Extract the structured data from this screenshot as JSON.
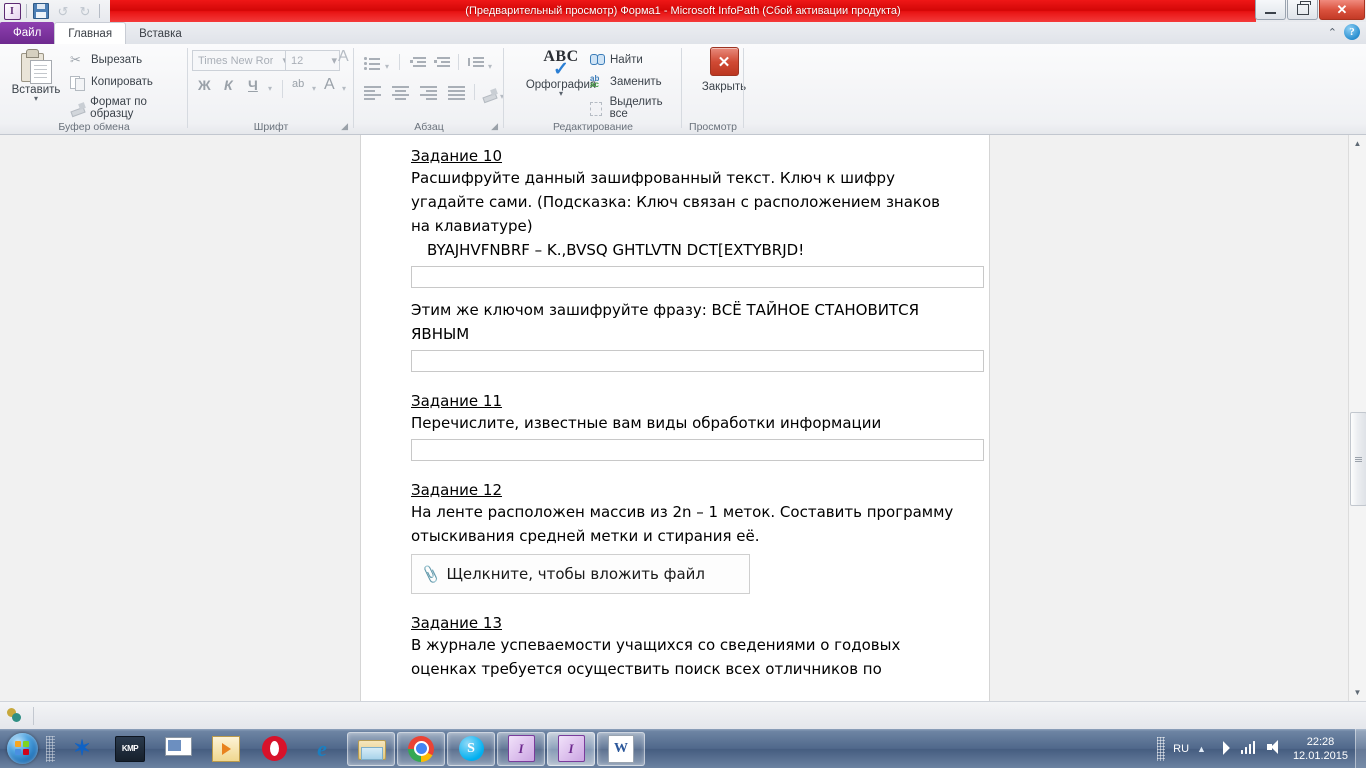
{
  "window": {
    "title": "(Предварительный просмотр) Форма1  -  Microsoft InfoPath (Сбой активации продукта)",
    "minimize_label": "",
    "restore_label": "",
    "close_label": "✕"
  },
  "quick_access": {
    "app_icon": "infopath-icon",
    "save_label": "save-icon",
    "undo_label": "↺",
    "redo_label": "↻",
    "customize_label": "▾"
  },
  "tabs": [
    {
      "label": "Файл",
      "id": "tab-file",
      "active": false
    },
    {
      "label": "Главная",
      "id": "tab-home",
      "active": true
    },
    {
      "label": "Вставка",
      "id": "tab-insert",
      "active": false
    }
  ],
  "ribbon_right": {
    "collapse_icon": "⌃",
    "help_icon": "?"
  },
  "ribbon": {
    "clipboard": {
      "group_label": "Буфер обмена",
      "paste_label": "Вставить",
      "paste_arrow": "▾",
      "cut_label": "Вырезать",
      "copy_label": "Копировать",
      "format_painter_label": "Формат по образцу"
    },
    "font": {
      "group_label": "Шрифт",
      "font_name": "Times New Ror",
      "font_size": "12",
      "bold_label": "Ж",
      "italic_label": "К",
      "underline_label": "Ч",
      "clear_format_label": "A",
      "highlight_label": "ab",
      "font_color_label": "A",
      "dropdown_arrow": "▾"
    },
    "paragraph": {
      "group_label": "Абзац",
      "bullets_label": "bullet-list-icon",
      "decrease_indent_label": "decrease-indent-icon",
      "increase_indent_label": "increase-indent-icon",
      "line_spacing_label": "line-spacing-icon",
      "align_left_label": "align-left-icon",
      "align_center_label": "align-center-icon",
      "align_right_label": "align-right-icon",
      "align_justify_label": "align-justify-icon",
      "shading_label": "shading-icon",
      "dialog_launcher": "◢"
    },
    "editing": {
      "group_label": "Редактирование",
      "spelling_label": "Орфография",
      "spelling_glyph": "ABC",
      "spelling_check": "✓",
      "spelling_arrow": "▾",
      "find_label": "Найти",
      "replace_label": "Заменить",
      "select_all_label": "Выделить все"
    },
    "preview": {
      "group_label": "Просмотр",
      "close_label": "Закрыть",
      "close_glyph": "✕"
    }
  },
  "document": {
    "blocks": [
      {
        "type": "task",
        "title": "Задание 10",
        "paragraphs": [
          "Расшифруйте данный зашифрованный текст. Ключ к шифру угадайте сами. (Подсказка: Ключ связан с расположением знаков на клавиатуре)"
        ],
        "cipher": "BYAJHVFNBRF – K.,BVSQ GHTLVTN DCT[EXTYBRJD!",
        "field_value": ""
      },
      {
        "type": "prompt",
        "paragraphs": [
          "Этим же ключом зашифруйте фразу: ВСЁ ТАЙНОЕ СТАНОВИТСЯ ЯВНЫМ"
        ],
        "field_value": ""
      },
      {
        "type": "task",
        "title": "Задание 11",
        "paragraphs": [
          "Перечислите, известные вам виды обработки информации"
        ],
        "field_value": ""
      },
      {
        "type": "task-attach",
        "title": "Задание 12",
        "paragraphs": [
          "На ленте расположен массив из 2n – 1 меток. Составить программу отыскивания средней метки и стирания её."
        ],
        "attachment_label": "Щелкните, чтобы вложить файл",
        "attachment_icon": "paperclip-icon"
      },
      {
        "type": "task-notail",
        "title": "Задание 13",
        "paragraphs": [
          "В журнале успеваемости учащихся со сведениями о годовых оценках требуется осуществить поиск всех отличников по"
        ]
      }
    ]
  },
  "scrollbar": {
    "up_arrow": "▲",
    "down_arrow": "▼"
  },
  "status_bar": {
    "icon": "form-status-icon"
  },
  "taskbar": {
    "start_label": "start-orb",
    "items": [
      {
        "name": "bluetooth-icon",
        "label": ""
      },
      {
        "name": "kmp-player-icon",
        "label": "KMP"
      },
      {
        "name": "remote-desktop-icon",
        "label": ""
      },
      {
        "name": "media-player-icon",
        "label": ""
      },
      {
        "name": "opera-icon",
        "label": "O"
      },
      {
        "name": "internet-explorer-icon",
        "label": "e"
      },
      {
        "name": "explorer-icon",
        "label": ""
      },
      {
        "name": "chrome-icon",
        "label": ""
      },
      {
        "name": "skype-icon",
        "label": "S"
      },
      {
        "name": "infopath-window-1",
        "label": "I"
      },
      {
        "name": "infopath-window-2",
        "label": "I"
      },
      {
        "name": "word-window",
        "label": "W"
      }
    ]
  },
  "tray": {
    "language": "RU",
    "chevron": "▲",
    "antivirus_icon": "kaspersky-icon",
    "network_icon": "network-signal-icon",
    "volume_icon": "volume-icon",
    "time": "22:28",
    "date": "12.01.2015"
  }
}
